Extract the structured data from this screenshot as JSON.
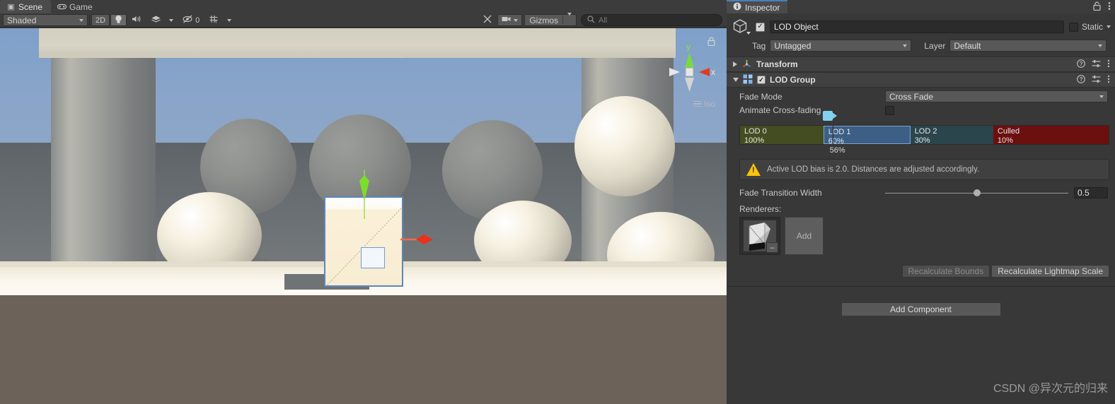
{
  "scene_panel": {
    "tabs": [
      {
        "label": "Scene",
        "icon": "grid-icon",
        "active": true
      },
      {
        "label": "Game",
        "icon": "gamepad-icon",
        "active": false
      }
    ],
    "toolbar": {
      "draw_mode": "Shaded",
      "two_d_label": "2D",
      "lighting_icon": "lightbulb-icon",
      "audio_icon": "speaker-icon",
      "fx_icon": "effects-icon",
      "hidden_objects_icon": "eye-off-icon",
      "hidden_objects_count": "0",
      "grid_icon": "grid-visibility-icon",
      "tools_icon": "tools-icon",
      "camera_icon": "scene-camera-icon",
      "gizmos_label": "Gizmos",
      "search_placeholder": "All",
      "search_value": ""
    },
    "view_gizmo": {
      "axis_y": "y",
      "axis_x": "x",
      "projection": "Iso",
      "lock_icon": "lock-icon"
    }
  },
  "inspector": {
    "tab_label": "Inspector",
    "tab_icon": "info-icon",
    "lock_icon": "lock-icon",
    "menu_icon": "kebab-menu-icon",
    "object": {
      "icon": "gameobject-cube-icon",
      "enabled": true,
      "name": "LOD Object",
      "static_label": "Static",
      "static_checked": false,
      "tag_label": "Tag",
      "tag_value": "Untagged",
      "layer_label": "Layer",
      "layer_value": "Default"
    },
    "components": [
      {
        "name": "Transform",
        "icon": "transform-axis-icon",
        "expanded": false,
        "has_checkbox": false
      },
      {
        "name": "LOD Group",
        "icon": "lod-group-icon",
        "expanded": true,
        "has_checkbox": true,
        "checked": true
      }
    ],
    "lod_group": {
      "fade_mode_label": "Fade Mode",
      "fade_mode_value": "Cross Fade",
      "animate_label": "Animate Cross-fading",
      "animate_checked": false,
      "camera_percent": "56%",
      "camera_marker_pos_pct": 25.2,
      "levels": [
        {
          "name": "LOD 0",
          "percent": "100%",
          "width_pct": 22.6,
          "color": "#434d21",
          "selected": false
        },
        {
          "name": "LOD 1",
          "percent": "60%",
          "width_pct": 23.6,
          "color": "#3d5f85",
          "selected": true
        },
        {
          "name": "LOD 2",
          "percent": "30%",
          "width_pct": 22.5,
          "color": "#2a454b",
          "selected": false
        },
        {
          "name": "Culled",
          "percent": "10%",
          "width_pct": 31.3,
          "color": "#6b0f0f",
          "selected": false
        }
      ],
      "warning": {
        "icon": "warning-triangle-icon",
        "text": "Active LOD bias is 2.0. Distances are adjusted accordingly."
      },
      "fade_transition_label": "Fade Transition Width",
      "fade_transition_value": "0.5",
      "fade_transition_pct": 50,
      "renderers_label": "Renderers:",
      "renderer_thumb_icon": "mesh-renderer-thumbnail",
      "renderer_remove_label": "–",
      "add_renderer_label": "Add",
      "recalculate_bounds_label": "Recalculate Bounds",
      "recalculate_lightmap_label": "Recalculate Lightmap Scale"
    },
    "add_component_label": "Add Component"
  },
  "watermark": "CSDN @异次元的归来",
  "colors": {
    "accent_blue": "#4a7ebb",
    "panel_bg": "#383838",
    "header_bg": "#414141",
    "warning_yellow": "#ffc30b",
    "camera_marker": "#80d2ef"
  }
}
